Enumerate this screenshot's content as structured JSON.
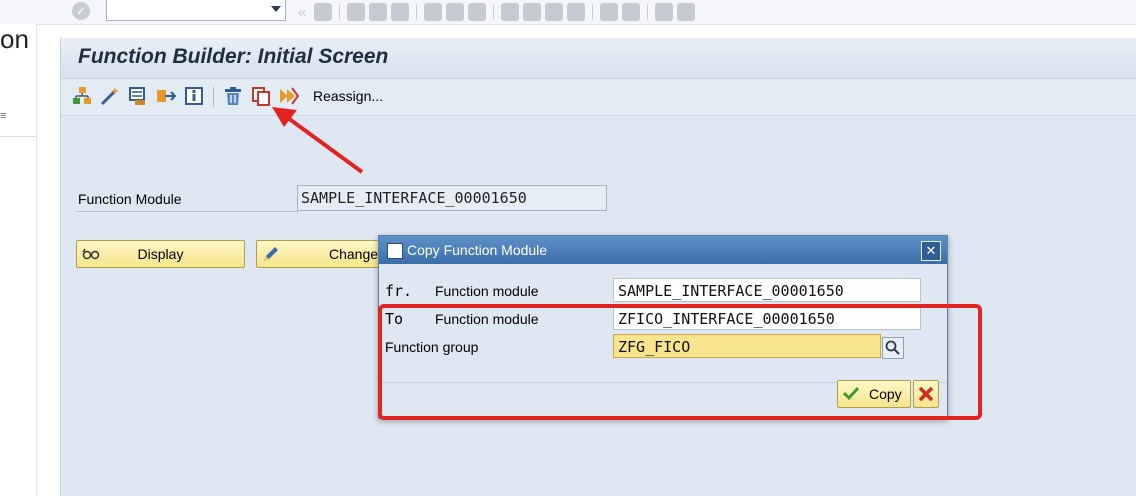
{
  "systembar": {
    "command_field_value": "",
    "ok_icon": "check-circle-icon",
    "guillemets": "«"
  },
  "left_fragment": {
    "text": "on"
  },
  "window": {
    "title": "Function Builder: Initial Screen"
  },
  "toolbar": {
    "reassign_label": "Reassign...",
    "icons": [
      "hierarchy-icon",
      "wizard-wand-icon",
      "test-icon",
      "transfer-icon",
      "info-icon",
      "delete-icon",
      "copy-icon",
      "rename-icon"
    ]
  },
  "form": {
    "function_module_label": "Function Module",
    "function_module_value": "SAMPLE_INTERFACE_00001650"
  },
  "buttons": {
    "display_label": "Display",
    "change_label": "Change"
  },
  "dialog": {
    "title": "Copy Function Module",
    "close_icon": "close-x-icon",
    "from_prefix": "fr.",
    "from_label": "Function module",
    "from_value": "SAMPLE_INTERFACE_00001650",
    "to_prefix": "To",
    "to_label": "Function module",
    "to_value": "ZFICO_INTERFACE_00001650",
    "group_label": "Function group",
    "group_value": "ZFG_FICO",
    "copy_label": "Copy",
    "cancel_icon": "cancel-x-icon"
  },
  "annotations": {
    "arrow_color": "#e32222",
    "highlight_color": "#e32222"
  }
}
